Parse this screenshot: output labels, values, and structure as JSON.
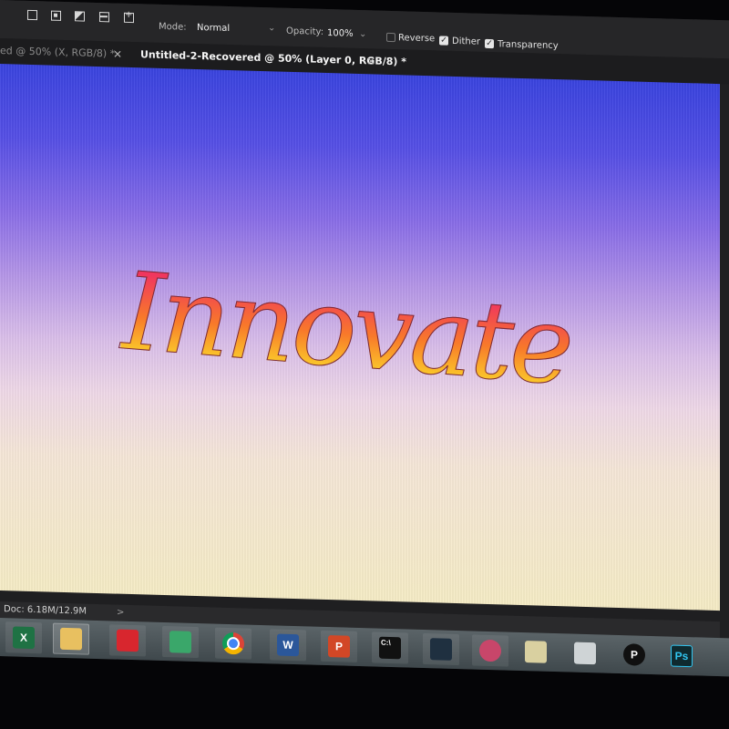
{
  "options_bar": {
    "mode_label": "Mode:",
    "mode_value": "Normal",
    "opacity_label": "Opacity:",
    "opacity_value": "100%",
    "reverse_label": "Reverse",
    "reverse_checked": false,
    "dither_label": "Dither",
    "dither_checked": true,
    "transparency_label": "Transparency",
    "transparency_checked": true
  },
  "tabs": [
    {
      "label": "ed @ 50% (X, RGB/8) *",
      "active": false
    },
    {
      "label": "Untitled-2-Recovered @ 50% (Layer 0, RGB/8) *",
      "active": true
    }
  ],
  "canvas": {
    "artwork_text": "Innovate",
    "gradient_top": "#3a44e0",
    "gradient_mid": "#dbc0ea",
    "gradient_bottom": "#f6ecc6",
    "text_gradient": [
      "#f0365e",
      "#f8792a",
      "#fbd02a"
    ]
  },
  "status_bar": {
    "doc_info": "Doc: 6.18M/12.9M",
    "arrow": ">"
  },
  "taskbar": {
    "apps": [
      {
        "name": "excel",
        "icon": "excel-icon",
        "glyph": "X",
        "color": "#1f7244"
      },
      {
        "name": "file-explorer",
        "icon": "folder-icon",
        "glyph": "",
        "color": "#e8c060"
      },
      {
        "name": "app-red",
        "icon": "red-app-icon",
        "glyph": "",
        "color": "#d8262e"
      },
      {
        "name": "app-green",
        "icon": "green-app-icon",
        "glyph": "",
        "color": "#3aa76a"
      },
      {
        "name": "chrome",
        "icon": "chrome-icon",
        "glyph": "",
        "color": "#dd4b39"
      },
      {
        "name": "word",
        "icon": "word-icon",
        "glyph": "W",
        "color": "#2b579a"
      },
      {
        "name": "powerpoint",
        "icon": "powerpoint-icon",
        "glyph": "P",
        "color": "#d24726"
      },
      {
        "name": "terminal",
        "icon": "terminal-icon",
        "glyph": "C:\\",
        "color": "#111111"
      },
      {
        "name": "app-teal",
        "icon": "teal-app-icon",
        "glyph": "",
        "color": "#1f3040"
      },
      {
        "name": "app-circle",
        "icon": "circle-app-icon",
        "glyph": "",
        "color": "#c8466a"
      },
      {
        "name": "notes",
        "icon": "notes-icon",
        "glyph": "",
        "color": "#d9d0a0"
      },
      {
        "name": "app-arrow",
        "icon": "arrow-app-icon",
        "glyph": "",
        "color": "#cfd4d6"
      },
      {
        "name": "app-p",
        "icon": "p-app-icon",
        "glyph": "P",
        "color": "#101010"
      },
      {
        "name": "photoshop",
        "icon": "photoshop-icon",
        "glyph": "Ps",
        "color": "#0f2a2f"
      }
    ]
  }
}
